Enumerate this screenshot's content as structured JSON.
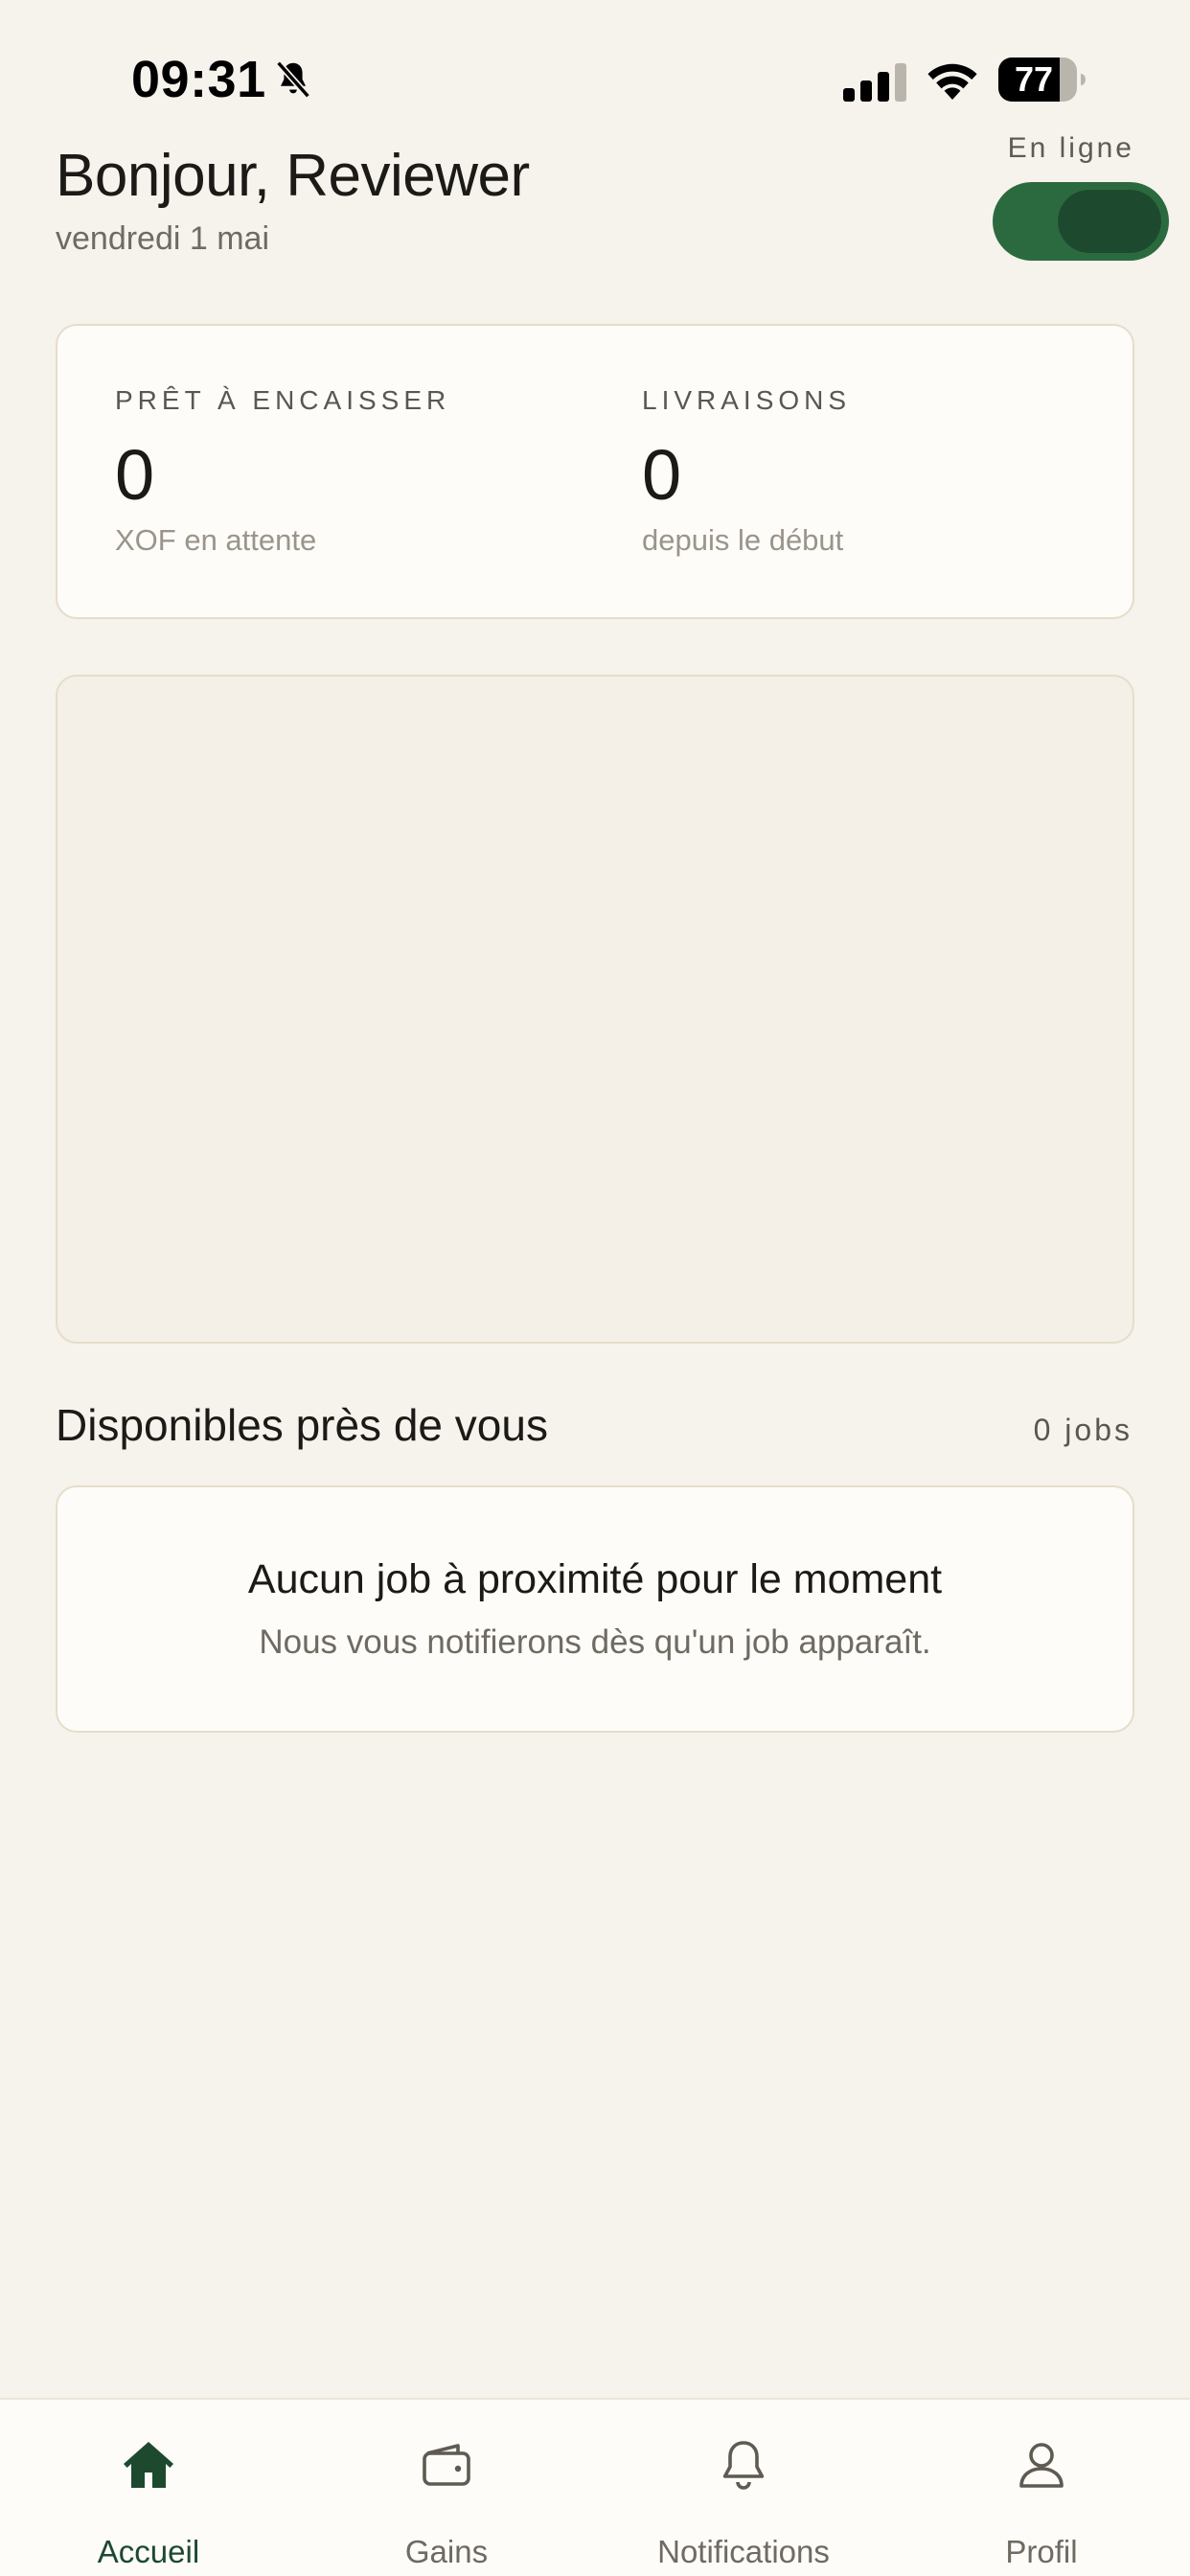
{
  "status_bar": {
    "time": "09:31",
    "battery": "77",
    "icons": [
      "bell-muted-icon",
      "signal-icon",
      "wifi-icon",
      "battery-icon"
    ]
  },
  "header": {
    "greeting": "Bonjour, Reviewer",
    "date": "vendredi 1 mai",
    "online_label": "En ligne",
    "online": true
  },
  "stats": {
    "ready": {
      "label": "PRÊT À ENCAISSER",
      "value": "0",
      "sub": "XOF en attente"
    },
    "deliveries": {
      "label": "LIVRAISONS",
      "value": "0",
      "sub": "depuis le début"
    }
  },
  "nearby": {
    "title": "Disponibles près de vous",
    "count": "0 jobs",
    "empty_title": "Aucun job à proximité pour le moment",
    "empty_sub": "Nous vous notifierons dès qu'un job apparaît."
  },
  "nav": {
    "items": [
      {
        "label": "Accueil",
        "icon": "home-icon",
        "active": true
      },
      {
        "label": "Gains",
        "icon": "wallet-icon",
        "active": false
      },
      {
        "label": "Notifications",
        "icon": "bell-icon",
        "active": false
      },
      {
        "label": "Profil",
        "icon": "user-icon",
        "active": false
      }
    ]
  },
  "colors": {
    "background": "#f6f2ec",
    "card": "#fdfcf8",
    "card_border": "#e6ddca",
    "accent": "#2b6a3f",
    "accent_dark": "#1d4a2f"
  }
}
